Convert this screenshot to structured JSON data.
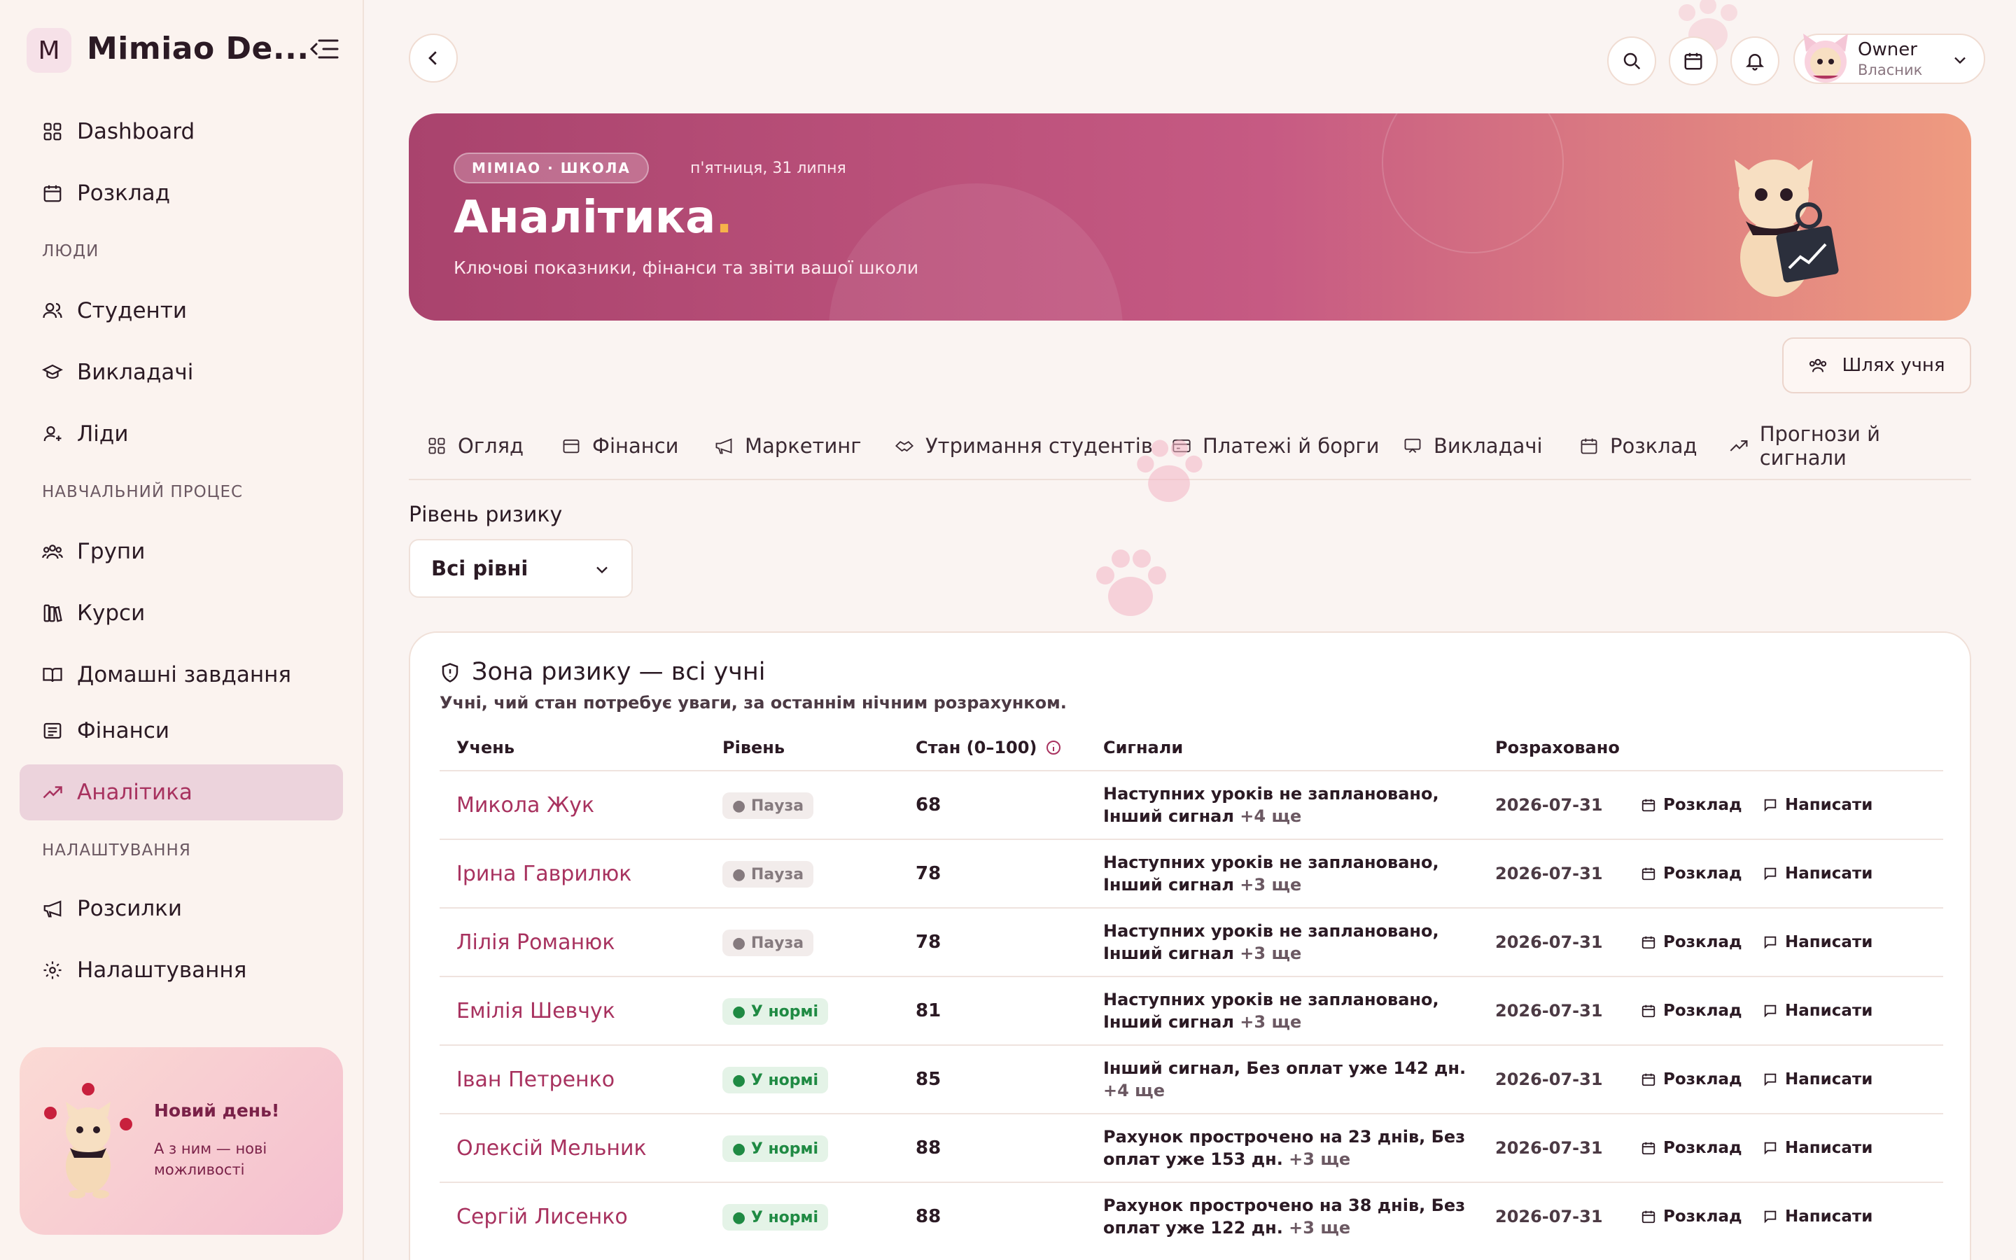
{
  "sidebar": {
    "logo_letter": "M",
    "brand": "Mimiao De...",
    "items": [
      {
        "label": "Dashboard"
      },
      {
        "label": "Розклад"
      },
      {
        "label": "Студенти"
      },
      {
        "label": "Викладачі"
      },
      {
        "label": "Ліди"
      },
      {
        "label": "Групи"
      },
      {
        "label": "Курси"
      },
      {
        "label": "Домашні завдання"
      },
      {
        "label": "Фінанси"
      },
      {
        "label": "Аналітика"
      },
      {
        "label": "Розсилки"
      },
      {
        "label": "Налаштування"
      }
    ],
    "sections": [
      "ЛЮДИ",
      "НАВЧАЛЬНИЙ ПРОЦЕС",
      "НАЛАШТУВАННЯ"
    ],
    "promo": {
      "title": "Новий день!",
      "text": "А з ним — нові можливості"
    }
  },
  "header": {
    "user_name": "Owner",
    "user_role": "Власник"
  },
  "hero": {
    "pill": "МІМІАО · ШКОЛА",
    "date": "п'ятниця, 31 липня",
    "title": "Аналітика",
    "title_dot": ".",
    "subtitle": "Ключові показники, фінанси та звіти вашої школи"
  },
  "student_path_button": "Шлях учня",
  "tabs": [
    {
      "label": "Огляд"
    },
    {
      "label": "Фінанси"
    },
    {
      "label": "Маркетинг"
    },
    {
      "label": "Утримання студентів"
    },
    {
      "label": "Платежі й борги"
    },
    {
      "label": "Викладачі"
    },
    {
      "label": "Розклад"
    },
    {
      "label": "Прогнози й сигнали"
    }
  ],
  "filter": {
    "label": "Рівень ризику",
    "value": "Всі рівні"
  },
  "risk_card": {
    "title": "Зона ризику — всі учні",
    "description": "Учні, чий стан потребує уваги, за останнім нічним розрахунком.",
    "columns": [
      "Учень",
      "Рівень",
      "Стан (0–100)",
      "Сигнали",
      "Розраховано"
    ],
    "action_schedule": "Розклад",
    "action_write": "Написати",
    "rows": [
      {
        "name": "Микола Жук",
        "level": "● Пауза",
        "level_kind": "pause",
        "score": "68",
        "signals": "Наступних уроків не заплановано, Інший сигнал",
        "more": "+4 ще",
        "calculated": "2026-07-31"
      },
      {
        "name": "Ірина Гаврилюк",
        "level": "● Пауза",
        "level_kind": "pause",
        "score": "78",
        "signals": "Наступних уроків не заплановано, Інший сигнал",
        "more": "+3 ще",
        "calculated": "2026-07-31"
      },
      {
        "name": "Лілія Романюк",
        "level": "● Пауза",
        "level_kind": "pause",
        "score": "78",
        "signals": "Наступних уроків не заплановано, Інший сигнал",
        "more": "+3 ще",
        "calculated": "2026-07-31"
      },
      {
        "name": "Емілія Шевчук",
        "level": "● У нормі",
        "level_kind": "ok",
        "score": "81",
        "signals": "Наступних уроків не заплановано, Інший сигнал",
        "more": "+3 ще",
        "calculated": "2026-07-31"
      },
      {
        "name": "Іван Петренко",
        "level": "● У нормі",
        "level_kind": "ok",
        "score": "85",
        "signals": "Інший сигнал, Без оплат уже 142 дн.",
        "more": "+4 ще",
        "calculated": "2026-07-31"
      },
      {
        "name": "Олексій Мельник",
        "level": "● У нормі",
        "level_kind": "ok",
        "score": "88",
        "signals": "Рахунок прострочено на 23 днів, Без оплат уже 153 дн.",
        "more": "+3 ще",
        "calculated": "2026-07-31"
      },
      {
        "name": "Сергій Лисенко",
        "level": "● У нормі",
        "level_kind": "ok",
        "score": "88",
        "signals": "Рахунок прострочено на 38 днів, Без оплат уже 122 дн.",
        "more": "+3 ще",
        "calculated": "2026-07-31"
      }
    ]
  },
  "colors": {
    "accent": "#a8325f",
    "hero_start": "#a9436d",
    "hero_end": "#ef9b80",
    "ok": "#1f8a43"
  }
}
